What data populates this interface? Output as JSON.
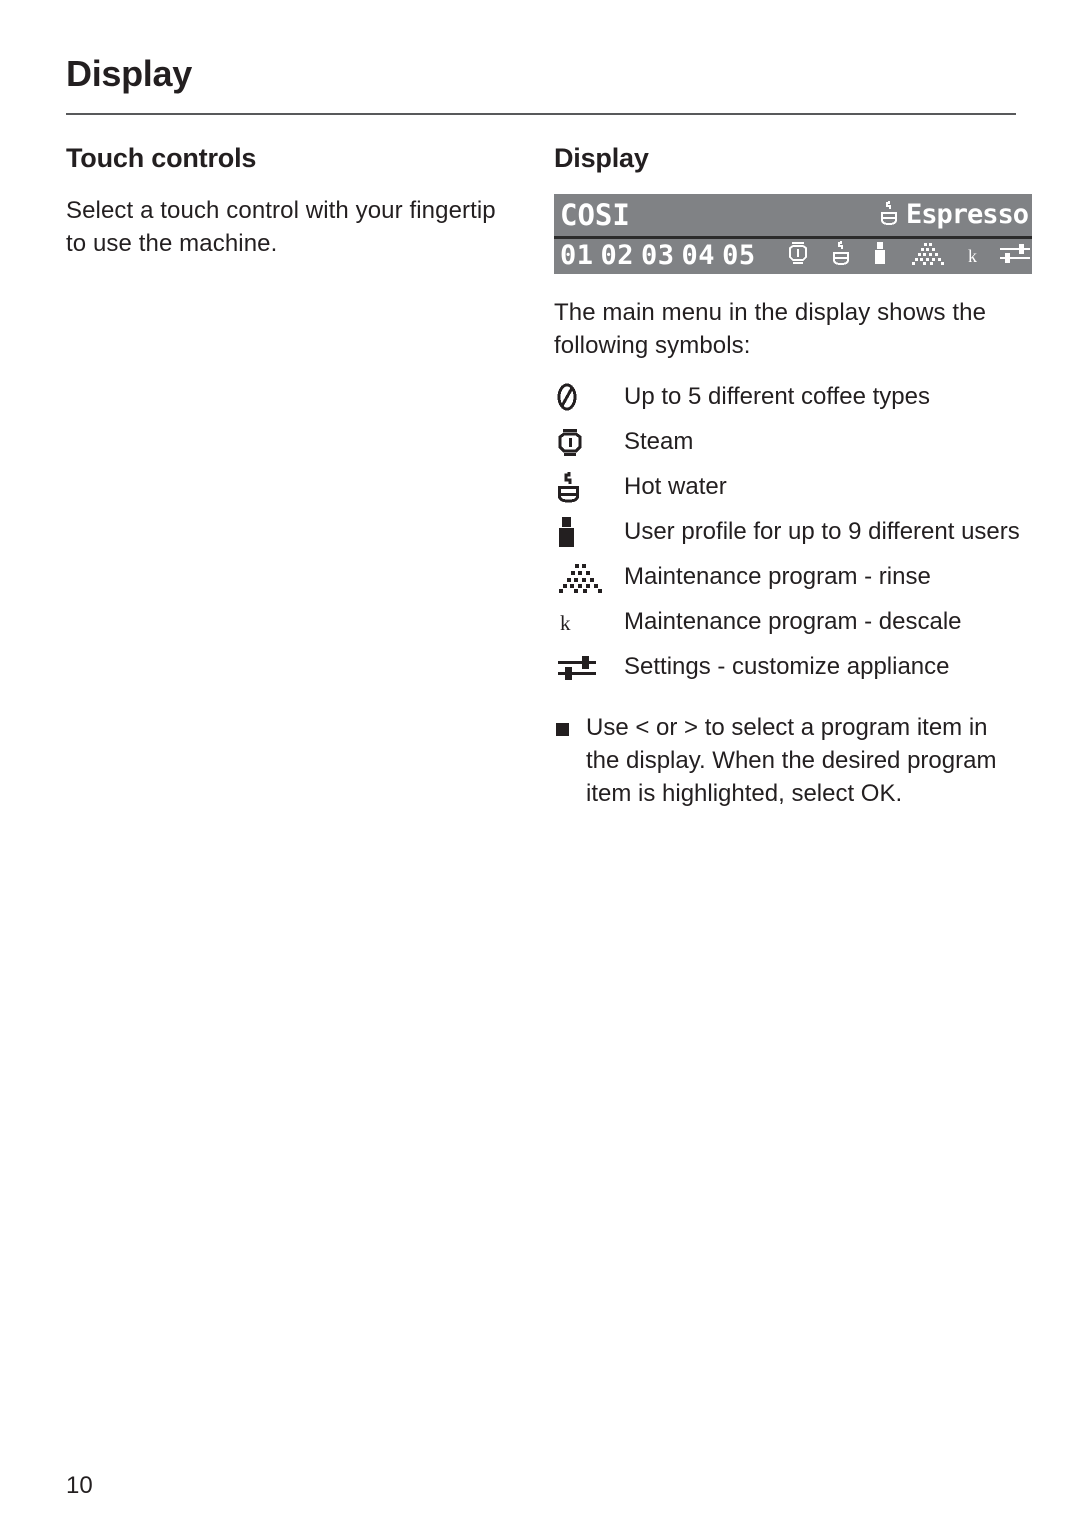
{
  "page": {
    "running_head": "Display",
    "folio": "10",
    "rule_color": "#58595b",
    "text_color": "#231f20"
  },
  "left_column": {
    "heading": "Touch controls",
    "paragraph": "Select a touch control with your fingertip to use the machine."
  },
  "right_column": {
    "heading": "Display",
    "intro": "The main menu in the display shows the following symbols:",
    "lcd": {
      "background_color": "#808285",
      "text_color": "#ffffff",
      "title": "COSI",
      "mode_label": "Espresso",
      "mode_icon": "hot-water-cup-icon",
      "program_numbers": [
        "01",
        "02",
        "03",
        "04",
        "05"
      ],
      "icons": [
        "steam-icon",
        "hot-water-icon",
        "user-profile-icon",
        "rinse-icon",
        "descale-icon",
        "settings-icon"
      ],
      "descale_glyph": "k"
    },
    "symbols": [
      {
        "icon": "coffee-bean-icon",
        "label": "Up to 5 different coffee types"
      },
      {
        "icon": "steam-icon",
        "label": "Steam"
      },
      {
        "icon": "hot-water-icon",
        "label": "Hot water"
      },
      {
        "icon": "user-profile-icon",
        "label": "User profile for up to 9 different users"
      },
      {
        "icon": "rinse-icon",
        "label": "Maintenance program - rinse"
      },
      {
        "icon": "descale-icon",
        "label": "Maintenance program - descale"
      },
      {
        "icon": "settings-icon",
        "label": "Settings - customize appliance"
      }
    ],
    "bullets": [
      "Use < or > to select a program item in the display. When the desired program item is highlighted, select OK."
    ]
  }
}
